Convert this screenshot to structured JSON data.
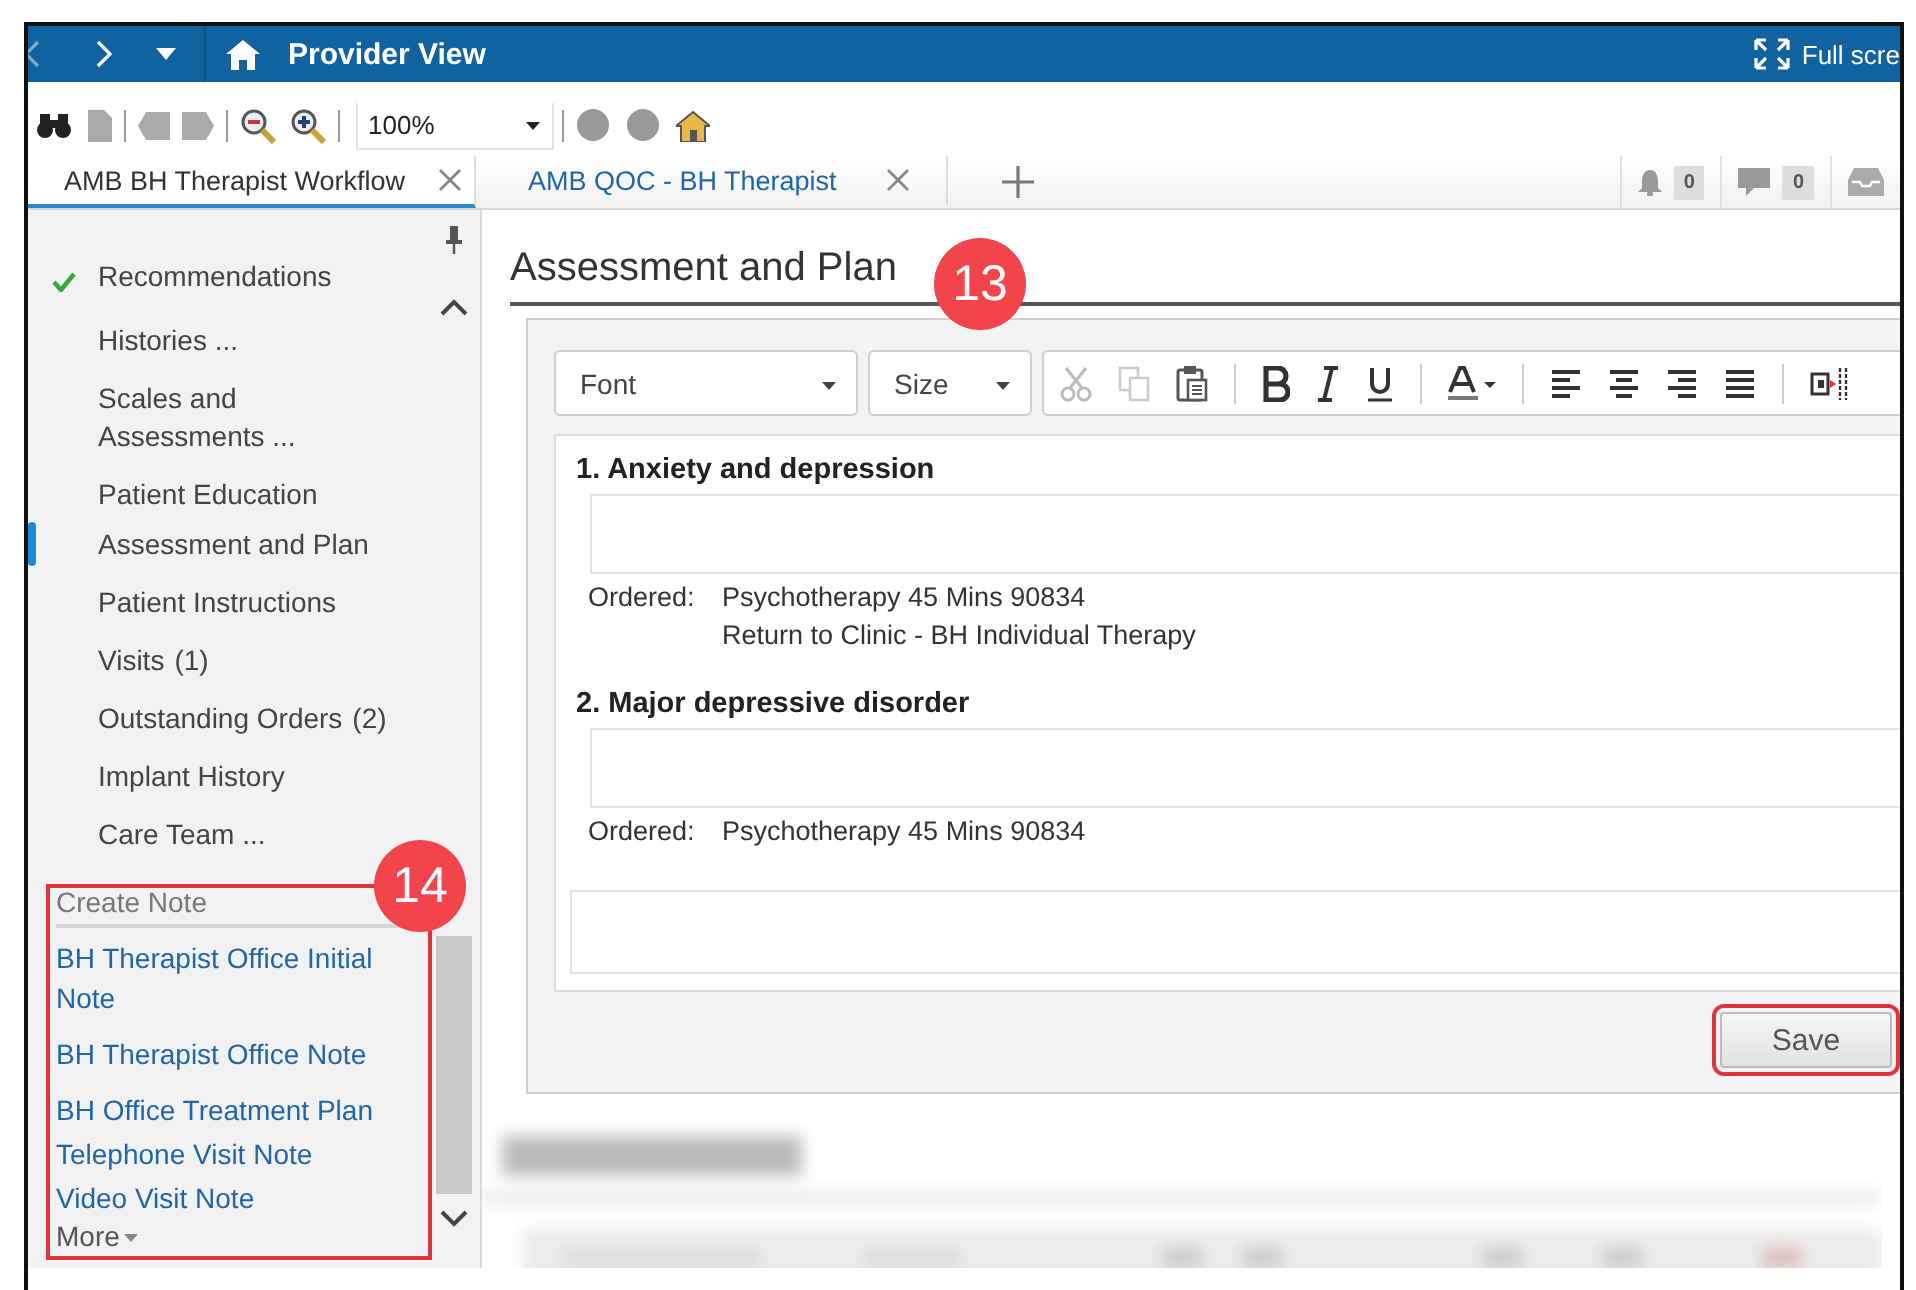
{
  "title_bar": {
    "title": "Provider View",
    "fullscreen_label": "Full scre"
  },
  "toolbar": {
    "zoom": "100%"
  },
  "tabs": [
    {
      "label": "AMB BH Therapist Workflow",
      "selected": true
    },
    {
      "label": "AMB QOC - BH Therapist",
      "selected": false
    }
  ],
  "notifications": [
    {
      "kind": "bell",
      "count": "0"
    },
    {
      "kind": "message",
      "count": "0"
    },
    {
      "kind": "inbox"
    }
  ],
  "sidebar": {
    "items": [
      {
        "label": "Recommendations",
        "checked": true,
        "selected": false
      },
      {
        "label": "Histories ...",
        "checked": false,
        "selected": false
      },
      {
        "label": "Scales and Assessments ...",
        "checked": false,
        "selected": false
      },
      {
        "label": "Patient Education",
        "checked": false,
        "selected": false
      },
      {
        "label": "Assessment and Plan",
        "checked": false,
        "selected": true
      },
      {
        "label": "Patient Instructions",
        "checked": false,
        "selected": false
      },
      {
        "label": "Visits",
        "count": "(1)",
        "checked": false,
        "selected": false
      },
      {
        "label": "Outstanding Orders",
        "count": "(2)",
        "checked": false,
        "selected": false
      },
      {
        "label": "Implant History",
        "checked": false,
        "selected": false
      },
      {
        "label": "Care Team ...",
        "checked": false,
        "selected": false
      }
    ],
    "create_note": {
      "title": "Create Note",
      "links": [
        "BH Therapist Office Initial Note",
        "BH Therapist Office Note",
        "BH Office Treatment Plan",
        "Telephone Visit Note",
        "Video Visit Note"
      ]
    },
    "more": "More"
  },
  "section": {
    "title": "Assessment and Plan",
    "font_select": "Font",
    "size_select": "Size",
    "problems": [
      {
        "title": "1. Anxiety and depression",
        "ordered_label": "Ordered:",
        "orders": [
          "Psychotherapy 45 Mins 90834",
          "Return to Clinic - BH Individual Therapy"
        ]
      },
      {
        "title": "2. Major depressive disorder",
        "ordered_label": "Ordered:",
        "orders": [
          "Psychotherapy 45 Mins 90834"
        ]
      }
    ],
    "save_button": "Save"
  },
  "callouts": [
    {
      "number": "13"
    },
    {
      "number": "14"
    }
  ]
}
